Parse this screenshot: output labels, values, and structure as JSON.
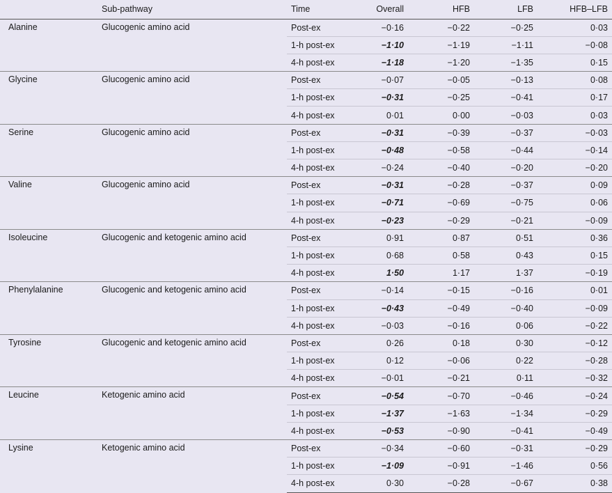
{
  "headers": [
    "",
    "Sub-pathway",
    "Time",
    "Overall",
    "HFB",
    "LFB",
    "HFB–LFB"
  ],
  "groups": [
    {
      "name": "Alanine",
      "pathway": "Glucogenic amino acid",
      "rows": [
        {
          "time": "Post-ex",
          "overall": "−0·16",
          "sig": false,
          "hfb": "−0·22",
          "lfb": "−0·25",
          "diff": "0·03"
        },
        {
          "time": "1-h post-ex",
          "overall": "−1·10",
          "sig": true,
          "hfb": "−1·19",
          "lfb": "−1·11",
          "diff": "−0·08"
        },
        {
          "time": "4-h post-ex",
          "overall": "−1·18",
          "sig": true,
          "hfb": "−1·20",
          "lfb": "−1·35",
          "diff": "0·15"
        }
      ]
    },
    {
      "name": "Glycine",
      "pathway": "Glucogenic amino acid",
      "rows": [
        {
          "time": "Post-ex",
          "overall": "−0·07",
          "sig": false,
          "hfb": "−0·05",
          "lfb": "−0·13",
          "diff": "0·08"
        },
        {
          "time": "1-h post-ex",
          "overall": "−0·31",
          "sig": true,
          "hfb": "−0·25",
          "lfb": "−0·41",
          "diff": "0·17"
        },
        {
          "time": "4-h post-ex",
          "overall": "0·01",
          "sig": false,
          "hfb": "0·00",
          "lfb": "−0·03",
          "diff": "0·03"
        }
      ]
    },
    {
      "name": "Serine",
      "pathway": "Glucogenic amino acid",
      "rows": [
        {
          "time": "Post-ex",
          "overall": "−0·31",
          "sig": true,
          "hfb": "−0·39",
          "lfb": "−0·37",
          "diff": "−0·03"
        },
        {
          "time": "1-h post-ex",
          "overall": "−0·48",
          "sig": true,
          "hfb": "−0·58",
          "lfb": "−0·44",
          "diff": "−0·14"
        },
        {
          "time": "4-h post-ex",
          "overall": "−0·24",
          "sig": false,
          "hfb": "−0·40",
          "lfb": "−0·20",
          "diff": "−0·20"
        }
      ]
    },
    {
      "name": "Valine",
      "pathway": "Glucogenic amino acid",
      "rows": [
        {
          "time": "Post-ex",
          "overall": "−0·31",
          "sig": true,
          "hfb": "−0·28",
          "lfb": "−0·37",
          "diff": "0·09"
        },
        {
          "time": "1-h post-ex",
          "overall": "−0·71",
          "sig": true,
          "hfb": "−0·69",
          "lfb": "−0·75",
          "diff": "0·06"
        },
        {
          "time": "4-h post-ex",
          "overall": "−0·23",
          "sig": true,
          "hfb": "−0·29",
          "lfb": "−0·21",
          "diff": "−0·09"
        }
      ]
    },
    {
      "name": "Isoleucine",
      "pathway": "Glucogenic and ketogenic amino acid",
      "rows": [
        {
          "time": "Post-ex",
          "overall": "0·91",
          "sig": false,
          "hfb": "0·87",
          "lfb": "0·51",
          "diff": "0·36"
        },
        {
          "time": "1-h post-ex",
          "overall": "0·68",
          "sig": false,
          "hfb": "0·58",
          "lfb": "0·43",
          "diff": "0·15"
        },
        {
          "time": "4-h post-ex",
          "overall": "1·50",
          "sig": true,
          "hfb": "1·17",
          "lfb": "1·37",
          "diff": "−0·19"
        }
      ]
    },
    {
      "name": "Phenylalanine",
      "pathway": "Glucogenic and ketogenic amino acid",
      "rows": [
        {
          "time": "Post-ex",
          "overall": "−0·14",
          "sig": false,
          "hfb": "−0·15",
          "lfb": "−0·16",
          "diff": "0·01"
        },
        {
          "time": "1-h post-ex",
          "overall": "−0·43",
          "sig": true,
          "hfb": "−0·49",
          "lfb": "−0·40",
          "diff": "−0·09"
        },
        {
          "time": "4-h post-ex",
          "overall": "−0·03",
          "sig": false,
          "hfb": "−0·16",
          "lfb": "0·06",
          "diff": "−0·22"
        }
      ]
    },
    {
      "name": "Tyrosine",
      "pathway": "Glucogenic and ketogenic amino acid",
      "rows": [
        {
          "time": "Post-ex",
          "overall": "0·26",
          "sig": false,
          "hfb": "0·18",
          "lfb": "0·30",
          "diff": "−0·12"
        },
        {
          "time": "1-h post-ex",
          "overall": "0·12",
          "sig": false,
          "hfb": "−0·06",
          "lfb": "0·22",
          "diff": "−0·28"
        },
        {
          "time": "4-h post-ex",
          "overall": "−0·01",
          "sig": false,
          "hfb": "−0·21",
          "lfb": "0·11",
          "diff": "−0·32"
        }
      ]
    },
    {
      "name": "Leucine",
      "pathway": "Ketogenic amino acid",
      "rows": [
        {
          "time": "Post-ex",
          "overall": "−0·54",
          "sig": true,
          "hfb": "−0·70",
          "lfb": "−0·46",
          "diff": "−0·24"
        },
        {
          "time": "1-h post-ex",
          "overall": "−1·37",
          "sig": true,
          "hfb": "−1·63",
          "lfb": "−1·34",
          "diff": "−0·29"
        },
        {
          "time": "4-h post-ex",
          "overall": "−0·53",
          "sig": true,
          "hfb": "−0·90",
          "lfb": "−0·41",
          "diff": "−0·49"
        }
      ]
    },
    {
      "name": "Lysine",
      "pathway": "Ketogenic amino acid",
      "rows": [
        {
          "time": "Post-ex",
          "overall": "−0·34",
          "sig": false,
          "hfb": "−0·60",
          "lfb": "−0·31",
          "diff": "−0·29"
        },
        {
          "time": "1-h post-ex",
          "overall": "−1·09",
          "sig": true,
          "hfb": "−0·91",
          "lfb": "−1·46",
          "diff": "0·56"
        },
        {
          "time": "4-h post-ex",
          "overall": "0·30",
          "sig": false,
          "hfb": "−0·28",
          "lfb": "−0·67",
          "diff": "0·38"
        }
      ]
    }
  ]
}
